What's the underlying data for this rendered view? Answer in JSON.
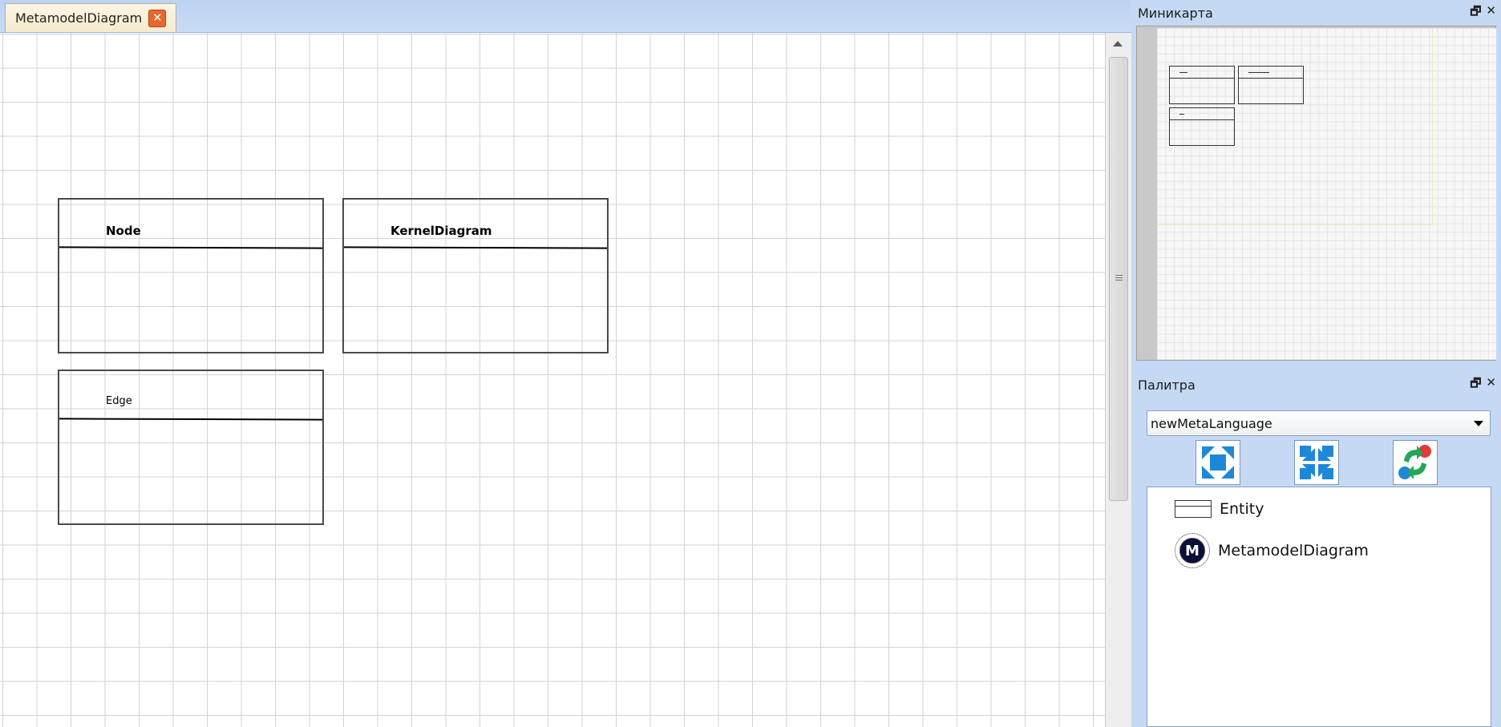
{
  "editor": {
    "tab_label": "MetamodelDiagram",
    "tab_close_glyph": "✕",
    "entities": [
      {
        "name": "Node"
      },
      {
        "name": "KernelDiagram"
      },
      {
        "name": "Edge"
      }
    ]
  },
  "minimap": {
    "title": "Миникарта",
    "float_glyph": "🗗",
    "close_glyph": "✕"
  },
  "palette": {
    "title": "Палитра",
    "float_glyph": "🗗",
    "close_glyph": "✕",
    "language": "newMetaLanguage",
    "buttons": [
      {
        "icon": "expand-icon"
      },
      {
        "icon": "collapse-icon"
      },
      {
        "icon": "refresh-icon"
      }
    ],
    "items": [
      {
        "label": "Entity",
        "icon": "entity-icon"
      },
      {
        "label": "MetamodelDiagram",
        "icon": "metamodel-diagram-icon",
        "icon_letter": "M"
      }
    ]
  },
  "colors": {
    "panel_bg": "#c6d9f4",
    "tab_close": "#e9662d",
    "accent_blue": "#1e88d8"
  }
}
